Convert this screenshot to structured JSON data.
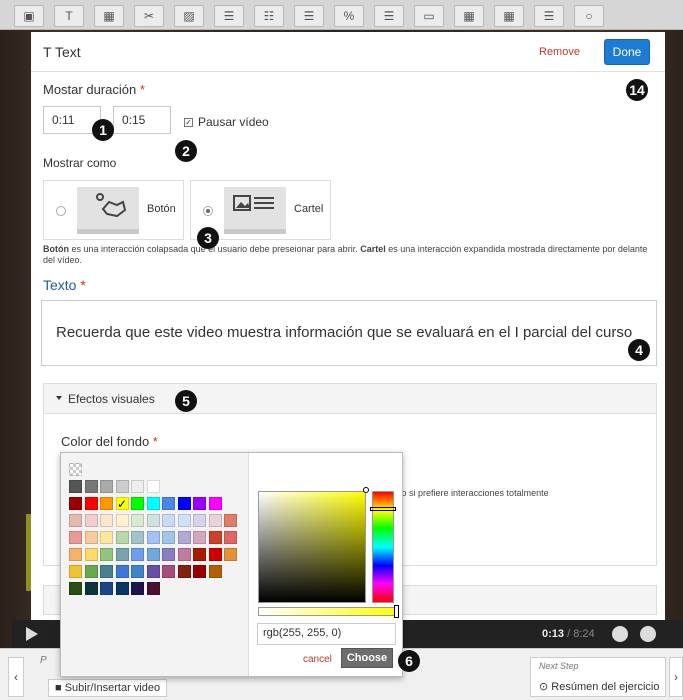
{
  "editor": {
    "video_time": {
      "current": "0:13",
      "total": "/ 8:24"
    }
  },
  "step_nav": {
    "prev_label": "P",
    "prev_name": "Subir/Insertar video",
    "next_label": "Next Step",
    "next_name": "Resúmen del ejercicio"
  },
  "dialog": {
    "title": "Text",
    "title_icon": "T",
    "remove_label": "Remove",
    "done_label": "Done",
    "duration_label": "Mostar duración",
    "required_mark": "*",
    "duration_from": "0:11",
    "duration_to": "0:15",
    "pause_label": "Pausar vídeo",
    "pause_checked": true,
    "display_as_label": "Mostrar como",
    "option_button_label": "Botón",
    "option_poster_label": "Cartel",
    "selected_option": "Cartel",
    "help_bold_1": "Botón",
    "help_text_1": " es una interacción colapsada que el usuario debe preseionar para abrir. ",
    "help_bold_2": "Cartel",
    "help_text_2": " es una interacción expandida mostrada directamente por delante del vídeo.",
    "text_label": "Texto",
    "text_value": "Recuerda que este video muestra información que se evaluará en el I parcial del curso",
    "effects_label": "Efectos visuales",
    "bg_color_label": "Color del fondo",
    "hidden_help": "tivar esto si prefiere interacciones totalmente"
  },
  "color_picker": {
    "current_color": "#ffff00",
    "rgb_value": "rgb(255, 255, 0)",
    "cancel_label": "cancel",
    "choose_label": "Choose",
    "palette_rows": [
      [
        "#ffffff"
      ],
      [
        "#555555",
        "#777777",
        "#aaaaaa",
        "#cccccc",
        "#eeeeee",
        "#ffffff"
      ],
      [
        "#990000",
        "#ff0000",
        "#ff9900",
        "#ffff00",
        "#00ff00",
        "#00ffff",
        "#4a86e8",
        "#0000ff",
        "#9900ff",
        "#ff00ff"
      ],
      [
        "#e6b8af",
        "#f4cccc",
        "#fce5cd",
        "#fff2cc",
        "#d9ead3",
        "#d0e0e3",
        "#c9daf8",
        "#cfe2f3",
        "#d9d2e9",
        "#ead1dc",
        "#dd7e6b"
      ],
      [
        "#ea9999",
        "#f9cb9c",
        "#ffe599",
        "#b6d7a8",
        "#a2c4c9",
        "#a4c2f4",
        "#9fc5e8",
        "#b4a7d6",
        "#d5a6bd",
        "#cc4125",
        "#e06666"
      ],
      [
        "#f6b26b",
        "#ffd966",
        "#93c47d",
        "#76a5af",
        "#6d9eeb",
        "#6fa8dc",
        "#8e7cc3",
        "#c27ba0",
        "#a61c00",
        "#cc0000",
        "#e69138"
      ],
      [
        "#f1c232",
        "#6aa84f",
        "#45818e",
        "#3c78d8",
        "#3d85c6",
        "#674ea7",
        "#a64d79",
        "#85200c",
        "#990000",
        "#b45f06"
      ],
      [
        "#274e13",
        "#0c343d",
        "#1c4587",
        "#073763",
        "#20124d",
        "#4c1130"
      ]
    ]
  },
  "badges": [
    "1",
    "2",
    "3",
    "4",
    "5",
    "6",
    "14"
  ]
}
